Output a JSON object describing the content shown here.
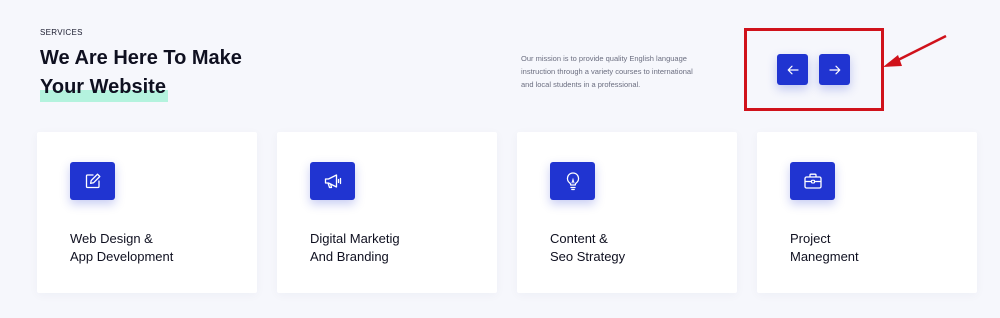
{
  "section": {
    "eyebrow": "SERVICES",
    "title_line1": "We Are Here To Make",
    "title_line2": "Your Website",
    "mission_line1": "Our mission is to provide quality English language",
    "mission_line2": "instruction through a variety courses to international",
    "mission_line3": "and local students in a professional."
  },
  "slider": {
    "prev_icon": "arrow-left-icon",
    "next_icon": "arrow-right-icon"
  },
  "cards": [
    {
      "icon": "edit-icon",
      "title_line1": "Web Design &",
      "title_line2": "App Development"
    },
    {
      "icon": "megaphone-icon",
      "title_line1": "Digital Marketig",
      "title_line2": "And Branding"
    },
    {
      "icon": "lightbulb-icon",
      "title_line1": "Content &",
      "title_line2": "Seo Strategy"
    },
    {
      "icon": "briefcase-icon",
      "title_line1": "Project",
      "title_line2": "Manegment"
    }
  ],
  "colors": {
    "accent": "#2034d1",
    "highlight": "#b4f3de",
    "annotation": "#d0121b",
    "background": "#f6f7fc"
  }
}
